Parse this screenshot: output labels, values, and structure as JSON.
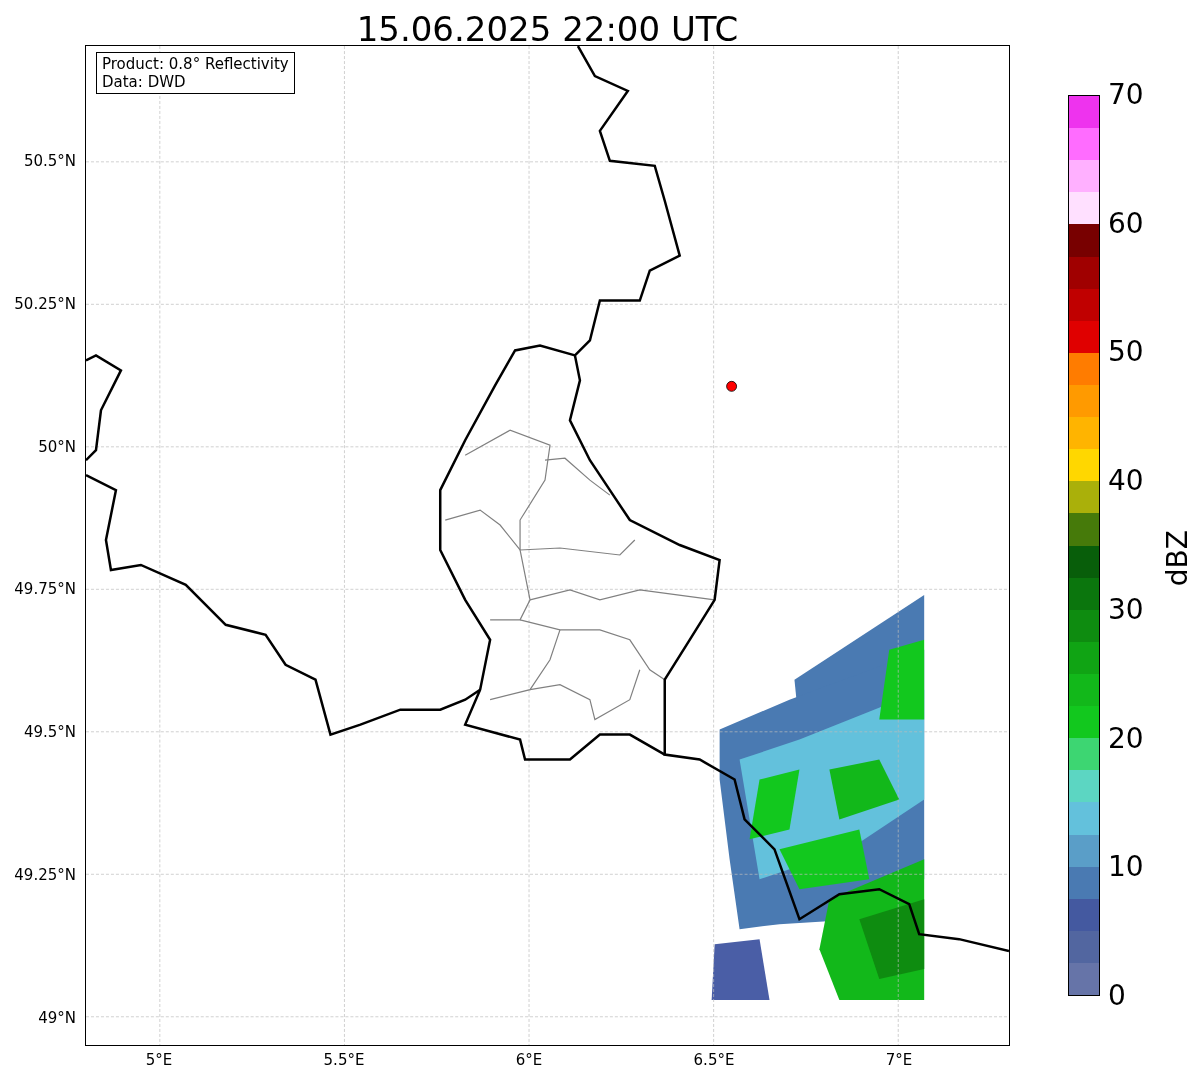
{
  "title": "15.06.2025 22:00 UTC",
  "info_box": [
    "Product: 0.8° Reflectivity",
    "Data: DWD"
  ],
  "lat_ticks": [
    "50.5°N",
    "50.25°N",
    "50°N",
    "49.75°N",
    "49.5°N",
    "49.25°N",
    "49°N"
  ],
  "lon_ticks": [
    "5°E",
    "5.5°E",
    "6°E",
    "6.5°E",
    "7°E"
  ],
  "colorbar": {
    "label": "dBZ",
    "ticks": [
      "70",
      "60",
      "50",
      "40",
      "30",
      "20",
      "10",
      "0"
    ],
    "bins": [
      {
        "color": "#ee33ee"
      },
      {
        "color": "#ff6cff"
      },
      {
        "color": "#ffb0ff"
      },
      {
        "color": "#ffe0ff"
      },
      {
        "color": "#780000"
      },
      {
        "color": "#a00000"
      },
      {
        "color": "#c00000"
      },
      {
        "color": "#e00000"
      },
      {
        "color": "#ff7c00"
      },
      {
        "color": "#ff9a00"
      },
      {
        "color": "#ffb400"
      },
      {
        "color": "#ffd700"
      },
      {
        "color": "#aab00a"
      },
      {
        "color": "#467a0a"
      },
      {
        "color": "#085e0a"
      },
      {
        "color": "#0b760d"
      },
      {
        "color": "#0e8c10"
      },
      {
        "color": "#10a414"
      },
      {
        "color": "#12b81a"
      },
      {
        "color": "#12c81e"
      },
      {
        "color": "#3dd672"
      },
      {
        "color": "#5cd6c2"
      },
      {
        "color": "#63c1dc"
      },
      {
        "color": "#5a9ec8"
      },
      {
        "color": "#4a7ab2"
      },
      {
        "color": "#4459a0"
      },
      {
        "color": "#5266a0"
      },
      {
        "color": "#6674a8"
      }
    ]
  }
}
